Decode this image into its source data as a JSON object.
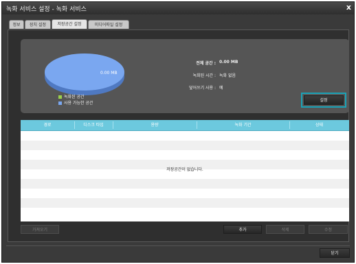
{
  "window": {
    "title": "녹화 서비스 설정 - 녹화 서비스",
    "close_glyph": "x"
  },
  "tabs": [
    {
      "label": "정보",
      "active": false
    },
    {
      "label": "장치 설정",
      "active": false
    },
    {
      "label": "저장공간 설정",
      "active": true
    },
    {
      "label": "미디어파일 설정",
      "active": false
    }
  ],
  "summary": {
    "pie_label": "0.00 MB",
    "legend": [
      {
        "label": "녹화된 공간",
        "color": "#9bd14c"
      },
      {
        "label": "사용 가능한 공간",
        "color": "#7aa7f0"
      }
    ],
    "total_label": "전체 공간 :",
    "total_value": "0.00 MB",
    "recorded_time_label": "녹화된 시간 :",
    "recorded_time_value": "녹화 없음",
    "overwrite_label": "덮어쓰기 사용 :",
    "overwrite_value": "예",
    "settings_button": "설정"
  },
  "table": {
    "columns": [
      "경로",
      "디스크 타입",
      "용량",
      "녹화 기간",
      "상태"
    ],
    "rows": [],
    "empty_message": "저장공간이 없습니다."
  },
  "buttons": {
    "import": "가져오기",
    "add": "추가",
    "delete": "삭제",
    "edit": "수정",
    "close": "닫기"
  },
  "colors": {
    "accent": "#1aa3b8",
    "table_header": "#6cc9de",
    "pie_available": "#7aa7f0",
    "pie_recorded": "#9bd14c"
  }
}
